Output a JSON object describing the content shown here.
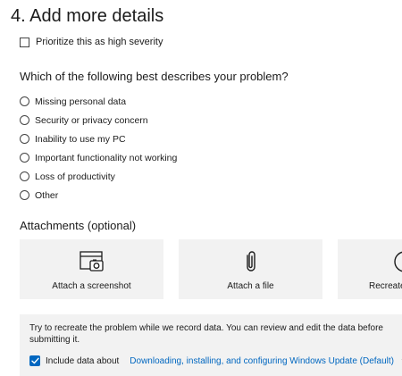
{
  "section": {
    "title": "4. Add more details"
  },
  "severity": {
    "label": "Prioritize this as high severity",
    "checked": false
  },
  "question": {
    "text": "Which of the following best describes your problem?",
    "options": [
      "Missing personal data",
      "Security or privacy concern",
      "Inability to use my PC",
      "Important functionality not working",
      "Loss of productivity",
      "Other"
    ]
  },
  "attachments": {
    "title": "Attachments (optional)",
    "tiles": [
      {
        "label": "Attach a screenshot",
        "icon": "screenshot-icon"
      },
      {
        "label": "Attach a file",
        "icon": "paperclip-icon"
      },
      {
        "label": "Recreate",
        "icon": "record-icon"
      }
    ]
  },
  "record": {
    "description": "Try to recreate the problem while we record data. You can review and edit the data before submitting it.",
    "include_label": "Include data about",
    "include_checked": true,
    "selected_category": "Downloading, installing, and configuring Windows Update (Default)"
  },
  "colors": {
    "accent": "#0067c0",
    "tile_bg": "#f2f2f2"
  }
}
